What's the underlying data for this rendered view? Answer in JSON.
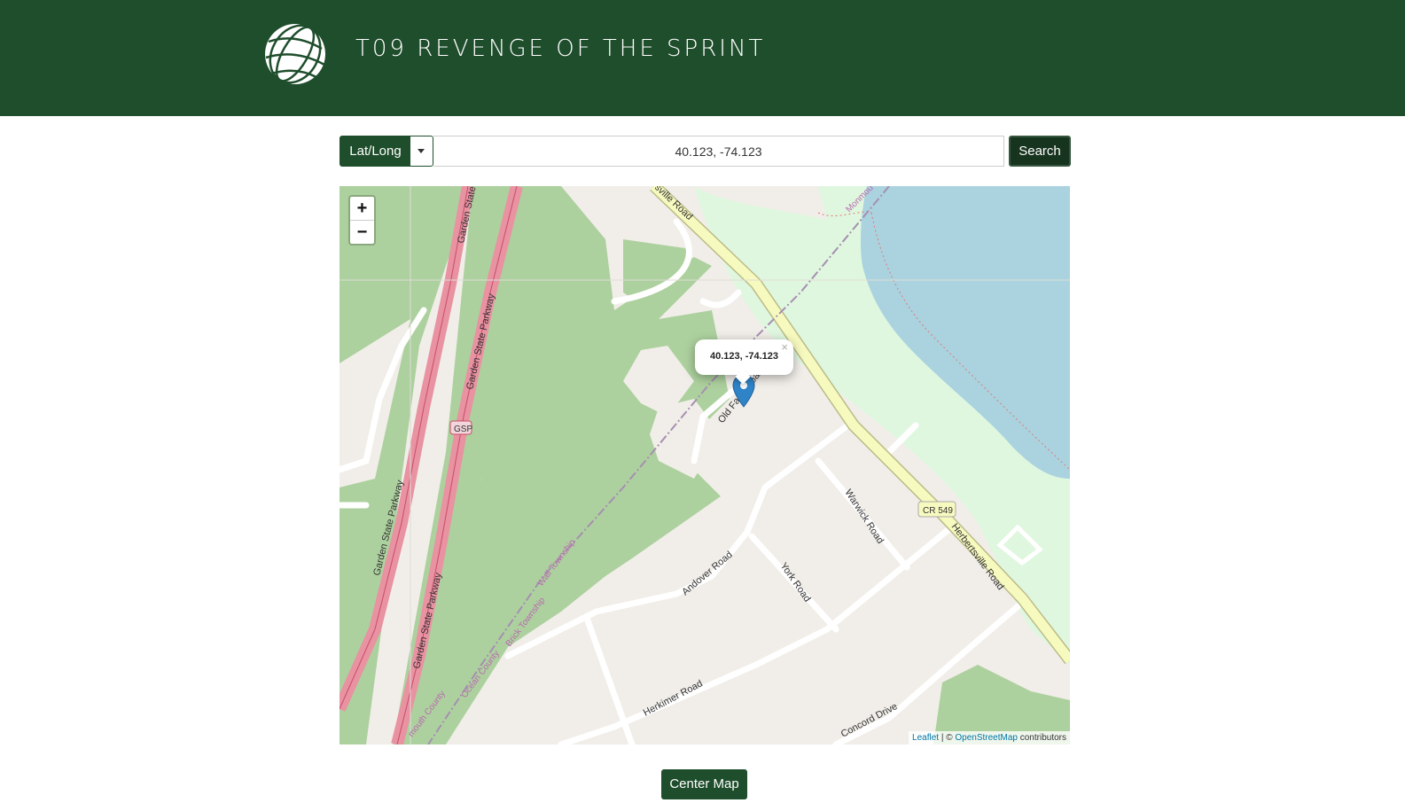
{
  "header": {
    "title": "T09 REVENGE OF THE SPRINT",
    "logo_icon": "globe-icon",
    "bg_color": "#1f4e2c"
  },
  "search": {
    "type_label": "Lat/Long",
    "query_value": "40.123, -74.123",
    "search_label": "Search"
  },
  "map": {
    "zoom_in": "+",
    "zoom_out": "−",
    "popup_text": "40.123, -74.123",
    "popup_close": "×",
    "attribution": {
      "leaflet": "Leaflet",
      "sep": " | © ",
      "osm": "OpenStreetMap",
      "suffix": " contributors"
    },
    "labels": {
      "gsp_1": "Garden State P",
      "gsp_2": "Garden State Parkway",
      "gsp_3": "Garden State Parkway",
      "gsp_4": "Garden State Parkway",
      "gsp_shield": "GSP",
      "sville": "sville Road",
      "monmouth": "Monmou",
      "old_farm": "Old Farm Road",
      "warwick": "Warwick Road",
      "cr549": "CR 549",
      "herbertsville": "Herbertsville Road",
      "york": "York Road",
      "andover": "Andover Road",
      "wall": "Wall Township",
      "brick": "Brick Township",
      "ocean": "Ocean County",
      "monmouth_county": "mouth County",
      "herkimer": "Herkimer Road",
      "concord": "Concord Drive"
    }
  },
  "footer": {
    "center_label": "Center Map"
  }
}
